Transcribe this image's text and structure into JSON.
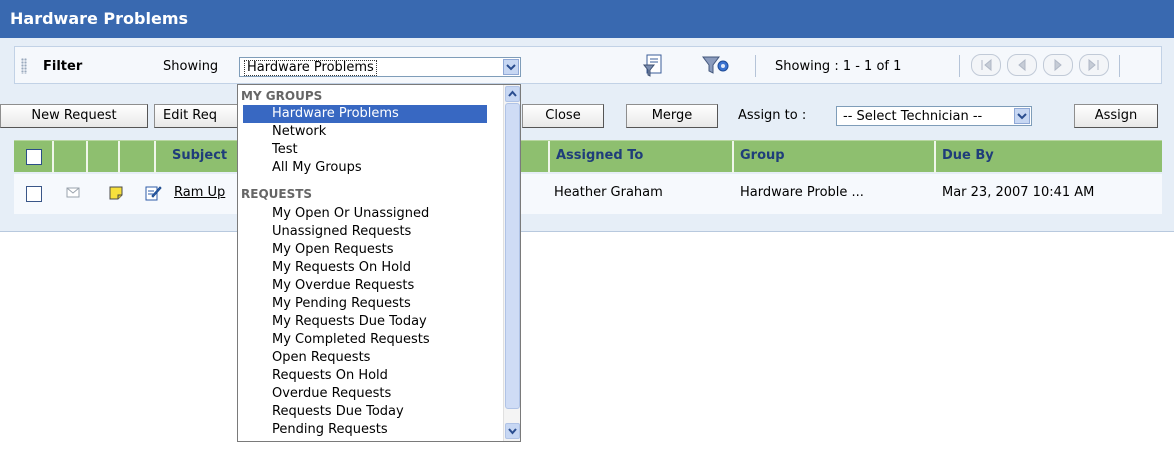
{
  "window": {
    "title": "Hardware Problems"
  },
  "filter_bar": {
    "filter_label": "Filter",
    "showing_label": "Showing",
    "selected_filter": "Hardware Problems",
    "showing_count": "Showing : 1 - 1 of 1"
  },
  "toolbar": {
    "new_request": "New Request",
    "edit_request": "Edit Req",
    "close": "Close",
    "merge": "Merge",
    "assign_to_label": "Assign to :",
    "technician_placeholder": "-- Select Technician --",
    "assign": "Assign"
  },
  "table": {
    "columns": [
      "Subject",
      "Assigned To",
      "Group",
      "Due By"
    ],
    "rows": [
      {
        "subject": "Ram Up",
        "assigned_to": "Heather Graham",
        "group": "Hardware Proble ...",
        "due_by": "Mar 23, 2007 10:41 AM"
      }
    ]
  },
  "dropdown": {
    "groups_header": "MY GROUPS",
    "groups": [
      "Hardware Problems",
      "Network",
      "Test",
      "All My Groups"
    ],
    "requests_header": "REQUESTS",
    "requests": [
      "My Open Or Unassigned",
      "Unassigned Requests",
      "My Open Requests",
      "My Requests On Hold",
      "My Overdue Requests",
      "My Pending Requests",
      "My Requests Due Today",
      "My Completed Requests",
      "Open Requests",
      "Requests On Hold",
      "Overdue Requests",
      "Requests Due Today",
      "Pending Requests"
    ]
  },
  "icons": {
    "filter": "filter-icon",
    "filter_settings": "filter-settings-icon",
    "mail": "mail-icon",
    "note": "note-icon",
    "edit": "edit-icon"
  },
  "colors": {
    "title_bar": "#3969b0",
    "header_row": "#8ebf6f",
    "header_text": "#1f3d7a",
    "selection": "#3868c2"
  }
}
